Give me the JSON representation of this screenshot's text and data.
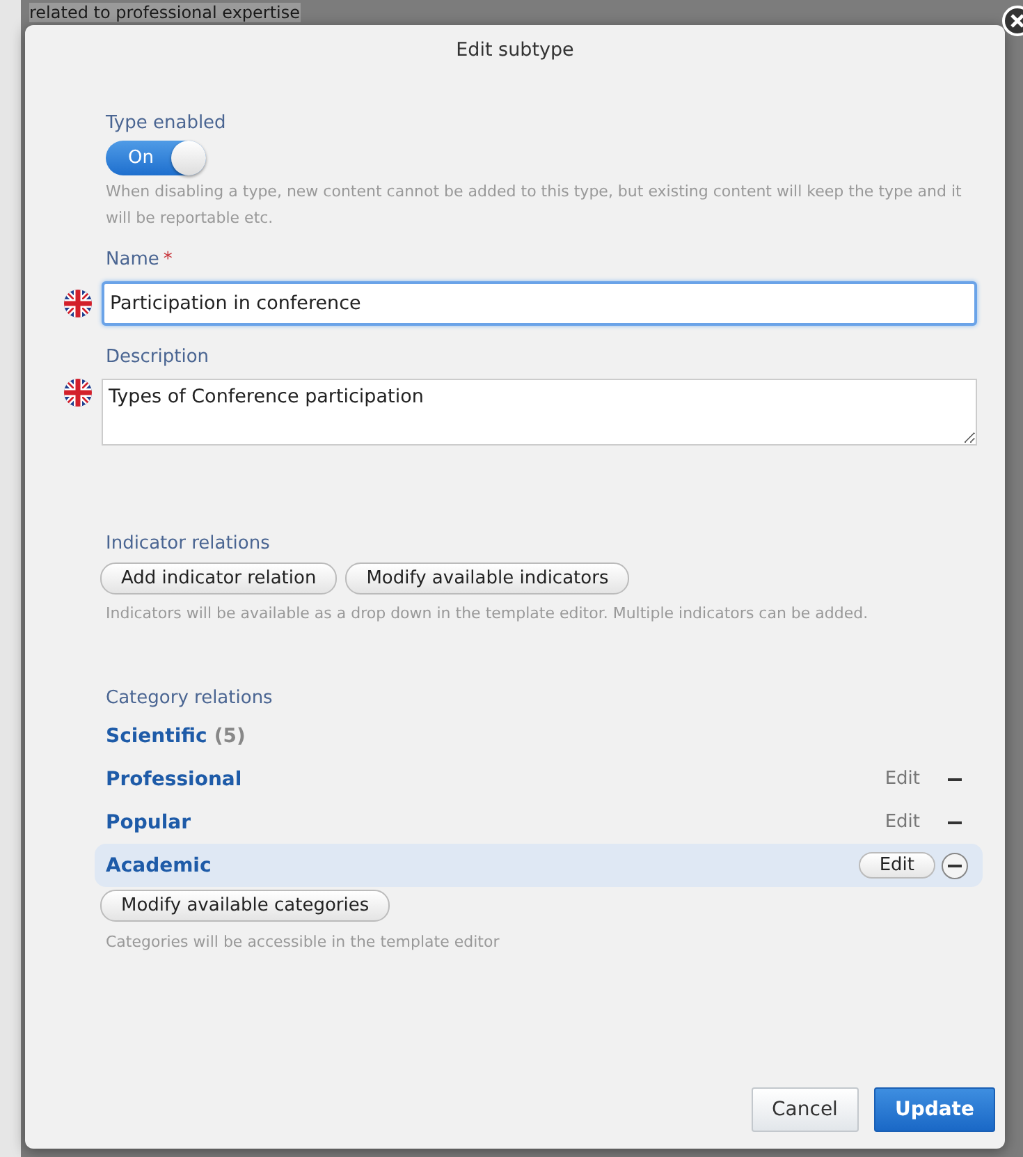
{
  "background_page": {
    "heading": "related to professional expertise"
  },
  "dialog": {
    "title": "Edit subtype",
    "type_enabled": {
      "label": "Type enabled",
      "on": true,
      "state_text": "On",
      "hint": "When disabling a type, new content cannot be added to this type, but existing content will keep the type and it will be reportable etc."
    },
    "name": {
      "label": "Name",
      "required": true,
      "required_mark": "*",
      "value": "Participation in conference",
      "focused": true
    },
    "description": {
      "label": "Description",
      "value": "Types of Conference participation"
    },
    "indicator_relations": {
      "label": "Indicator relations",
      "buttons": [
        "Add indicator relation",
        "Modify available indicators"
      ],
      "hint": "Indicators will be available as a drop down in the template editor. Multiple indicators can be added."
    },
    "category_relations": {
      "label": "Category relations",
      "items": [
        {
          "name": "Scientific",
          "count": "(5)",
          "highlighted": false
        },
        {
          "name": "Professional",
          "edit": "Edit",
          "highlighted": false
        },
        {
          "name": "Popular",
          "edit": "Edit",
          "highlighted": false
        },
        {
          "name": "Academic",
          "edit": "Edit",
          "highlighted": true
        }
      ],
      "button": "Modify available categories",
      "hint": "Categories will be accessible in the template editor"
    },
    "buttons": [
      {
        "label": "Cancel",
        "kind": "secondary"
      },
      {
        "label": "Update",
        "kind": "primary"
      }
    ]
  }
}
